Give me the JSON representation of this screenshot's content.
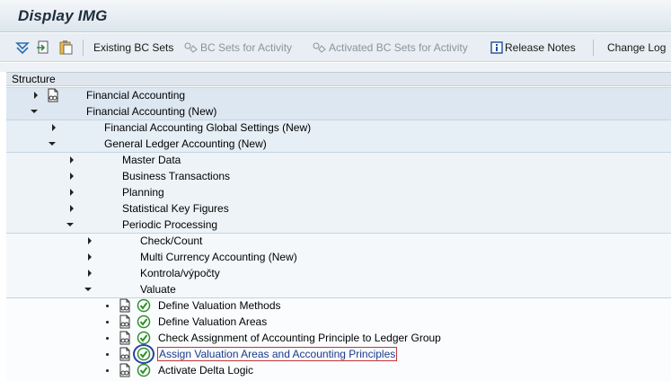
{
  "window": {
    "title": "Display IMG"
  },
  "toolbar": {
    "existing_bc_sets": "Existing BC Sets",
    "bc_sets_for_activity": "BC Sets for Activity",
    "activated_bc_sets": "Activated BC Sets for Activity",
    "release_notes": "Release Notes",
    "change_log": "Change Log"
  },
  "structure": {
    "header": "Structure",
    "nodes": {
      "fi": "Financial Accounting",
      "fi_new": "Financial Accounting (New)",
      "fi_global": "Financial Accounting Global Settings (New)",
      "gl_new": "General Ledger Accounting (New)",
      "master_data": "Master Data",
      "business_transactions": "Business Transactions",
      "planning": "Planning",
      "statistical_key_figures": "Statistical Key Figures",
      "periodic_processing": "Periodic Processing",
      "check_count": "Check/Count",
      "multi_currency": "Multi Currency Accounting (New)",
      "kontrola": "Kontrola/výpočty",
      "valuate": "Valuate",
      "define_valuation_methods": "Define Valuation Methods",
      "define_valuation_areas": "Define Valuation Areas",
      "check_assignment": "Check Assignment of Accounting Principle to Ledger Group",
      "assign_valuation_areas": "Assign Valuation Areas and Accounting Principles",
      "activate_delta_logic": "Activate Delta Logic"
    }
  },
  "colors": {
    "band_level1": "#dde7f1",
    "band_level2": "#e6eef6",
    "band_level3": "#eef3f8",
    "band_level4": "#f5f8fb",
    "band_level5": "#fafcfd",
    "highlight_circle": "#2e3fa8",
    "focus_border": "#c4343a"
  }
}
